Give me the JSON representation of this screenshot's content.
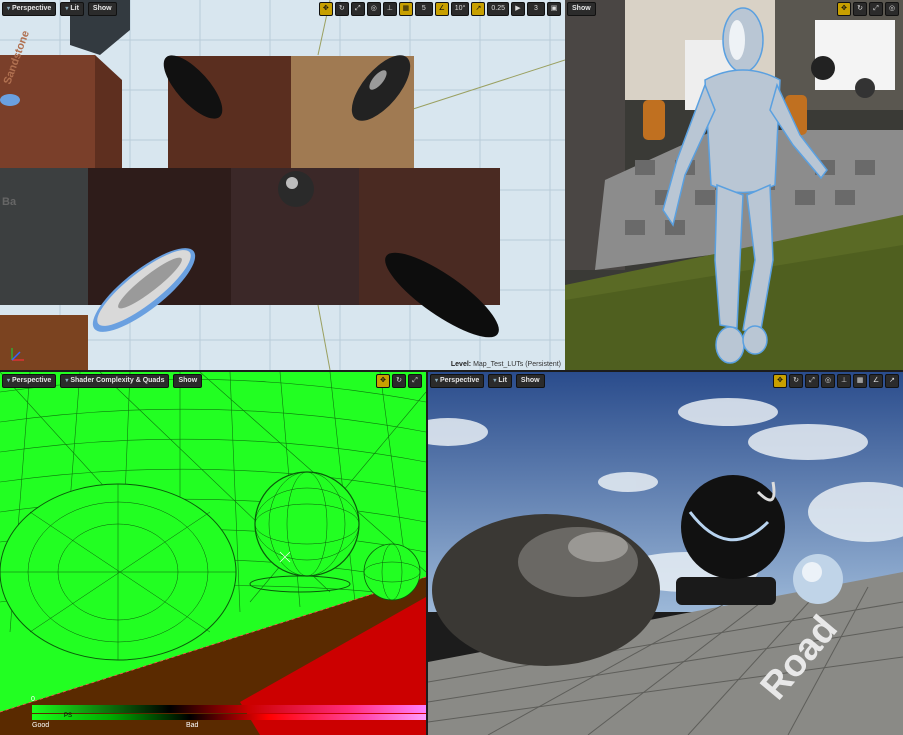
{
  "viewports": {
    "top_left": {
      "perspective": "Perspective",
      "view_mode": "Lit",
      "show": "Show",
      "grid_snap": "5",
      "rotation_snap": "10°",
      "scale_snap": "0.25",
      "camera_speed": "3",
      "level_label": "Level:",
      "level_name": "Map_Test_LUTs (Persistent)",
      "texture_text_1": "Sandstone",
      "texture_text_2": "Ba"
    },
    "top_right": {
      "show": "Show"
    },
    "bottom_left": {
      "perspective": "Perspective",
      "view_mode": "Shader Complexity & Quads",
      "show": "Show",
      "legend_zero": "0",
      "legend_ps": "PS",
      "legend_good": "Good",
      "legend_bad": "Bad"
    },
    "bottom_right": {
      "perspective": "Perspective",
      "view_mode": "Lit",
      "show": "Show",
      "floor_text": "Road"
    }
  },
  "colors": {
    "active_border": "#c8a000",
    "shader_green": "#22ff22",
    "shader_floor": "#5a2a00",
    "shader_red": "#cc0000"
  }
}
